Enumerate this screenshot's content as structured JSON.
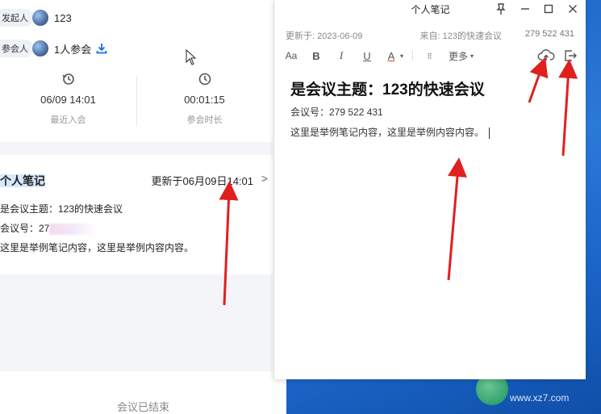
{
  "left_panel": {
    "organizer_label": "发起人",
    "organizer_value": "123",
    "participants_label": "参会人",
    "participants_value": "1人参会",
    "stats": [
      {
        "icon": "history-icon",
        "value": "06/09 14:01",
        "label": "最近入会"
      },
      {
        "icon": "clock-icon",
        "value": "00:01:15",
        "label": "参会时长"
      }
    ],
    "notes_card": {
      "title": "个人笔记",
      "updated": "更新于06月09日14:01",
      "chevron": ">",
      "line1": "是会议主题：123的快速会议",
      "line2_prefix": "会议号：27",
      "line3": "这里是举例笔记内容，这里是举例内容内容。"
    },
    "ended_text": "会议已结束"
  },
  "notes_window": {
    "title": "个人笔记",
    "updated": "更新于: 2023-06-09",
    "source": "来自: 123的快速会议",
    "meeting_number": "279 522 431",
    "toolbar": {
      "font_size": "Aa",
      "bold": "B",
      "italic": "I",
      "underline": "U",
      "font_color": "A",
      "list": "⁝⁝",
      "more": "更多"
    },
    "doc_title": "是会议主题：123的快速会议",
    "doc_line1": "会议号：279 522 431",
    "doc_line2": "这里是举例笔记内容，这里是举例内容内容。"
  },
  "desktop": {
    "watermark": "www.xz7.com"
  },
  "colors": {
    "accent": "#1a6ddc",
    "arrow": "#e0201e",
    "desktop_blue": "#2a7ad8",
    "panel_bg": "#f3f5f8"
  }
}
